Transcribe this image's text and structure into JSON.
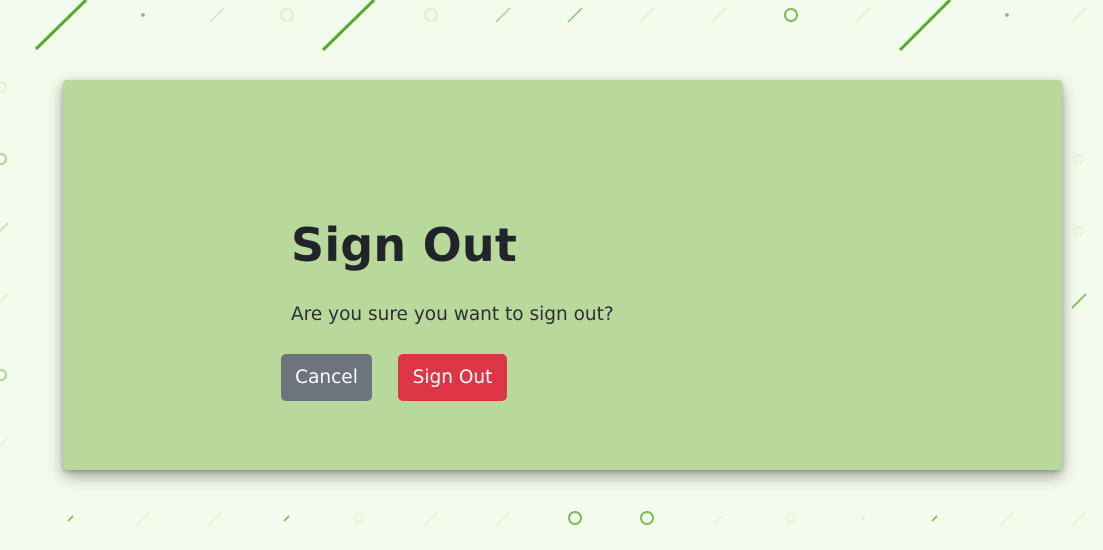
{
  "dialog": {
    "title": "Sign Out",
    "message": "Are you sure you want to sign out?",
    "cancel_label": "Cancel",
    "confirm_label": "Sign Out"
  },
  "colors": {
    "page_background": "#f3fbec",
    "card_background": "#b8d89c",
    "decor_green": "#5aa82e",
    "cancel_button": "#6c757d",
    "confirm_button": "#dc3545",
    "title_text": "#212529"
  }
}
